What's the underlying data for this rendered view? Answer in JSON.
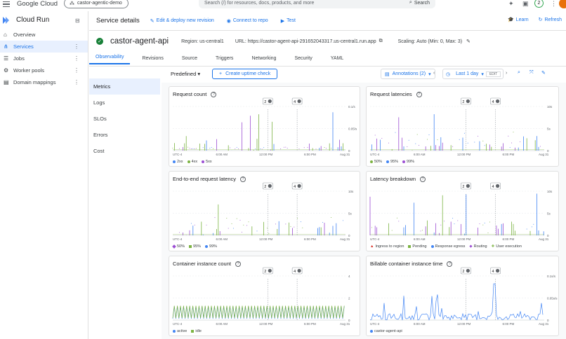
{
  "topbar": {
    "brand": "Google Cloud",
    "project": "castor-agentic-demo",
    "search_placeholder": "Search (/) for resources, docs, products, and more",
    "search_button": "Search",
    "notification_count": "2"
  },
  "sidebar": {
    "product": "Cloud Run",
    "items": [
      {
        "label": "Overview",
        "icon": "overview-icon"
      },
      {
        "label": "Services",
        "icon": "services-icon",
        "active": true
      },
      {
        "label": "Jobs",
        "icon": "jobs-icon"
      },
      {
        "label": "Worker pools",
        "icon": "worker-pools-icon"
      },
      {
        "label": "Domain mappings",
        "icon": "domain-mappings-icon"
      }
    ]
  },
  "header": {
    "title": "Service details",
    "actions": [
      "Edit & deploy new revision",
      "Connect to repo",
      "Test"
    ],
    "learn": "Learn",
    "refresh": "Refresh"
  },
  "service": {
    "name": "castor-agent-api",
    "region": "Region: us-central1",
    "url": "URL: https://castor-agent-api-291652043317.us-central1.run.app",
    "scaling": "Scaling: Auto (Min: 0, Max: 3)"
  },
  "tabs": [
    "Observability",
    "Revisions",
    "Source",
    "Triggers",
    "Networking",
    "Security",
    "YAML"
  ],
  "subnav": [
    "Metrics",
    "Logs",
    "SLOs",
    "Errors",
    "Cost"
  ],
  "toolbar": {
    "preset": "Predefined",
    "uptime": "Create uptime check",
    "annotations": "Annotations (2)",
    "range": "Last 1 day",
    "edit": "EDIT"
  },
  "colors": {
    "blue": "#4285f4",
    "green": "#7cb342",
    "purple": "#9c4fd3",
    "accent": "#1a73e8"
  },
  "charts": [
    {
      "title": "Request count",
      "yticks": [
        "0.1/s",
        "0.05/s",
        "0"
      ],
      "xticks": [
        "UTC-4",
        "6:00 AM",
        "12:00 PM",
        "6:00 PM",
        "Aug 31"
      ],
      "legend": [
        "2xx",
        "4xx",
        "5xx"
      ]
    },
    {
      "title": "Request latencies",
      "yticks": [
        "10s",
        "5s",
        "0"
      ],
      "xticks": [
        "UTC-4",
        "6:00 AM",
        "12:00 PM",
        "6:00 PM",
        "Aug 31"
      ],
      "legend": [
        "50%",
        "95%",
        "99%"
      ]
    },
    {
      "title": "End-to-end request latency",
      "yticks": [
        "10s",
        "5s",
        "0"
      ],
      "xticks": [
        "UTC-4",
        "6:00 AM",
        "12:00 PM",
        "6:00 PM",
        "Aug 31"
      ],
      "legend": [
        "50%",
        "95%",
        "99%"
      ]
    },
    {
      "title": "Latency breakdown",
      "yticks": [
        "10s",
        "5s",
        "0"
      ],
      "xticks": [
        "UTC-4",
        "6:00 AM",
        "12:00 PM",
        "6:00 PM",
        "Aug 31"
      ],
      "legend": [
        "Ingress to region",
        "Pending",
        "Response egress",
        "Routing",
        "User execution"
      ]
    },
    {
      "title": "Container instance count",
      "yticks": [
        "4",
        "2",
        "0"
      ],
      "xticks": [
        "UTC-4",
        "6:00 AM",
        "12:00 PM",
        "6:00 PM",
        "Aug 31"
      ],
      "legend": [
        "active",
        "idle"
      ]
    },
    {
      "title": "Billable container instance time",
      "yticks": [
        "0.1s/s",
        "0.05s/s",
        "0"
      ],
      "xticks": [
        "UTC-4",
        "6:00 AM",
        "12:00 PM",
        "6:00 PM",
        "Aug 31"
      ],
      "legend": [
        "castor-agent-api"
      ]
    }
  ],
  "annotation_markers": [
    "2",
    "4"
  ]
}
